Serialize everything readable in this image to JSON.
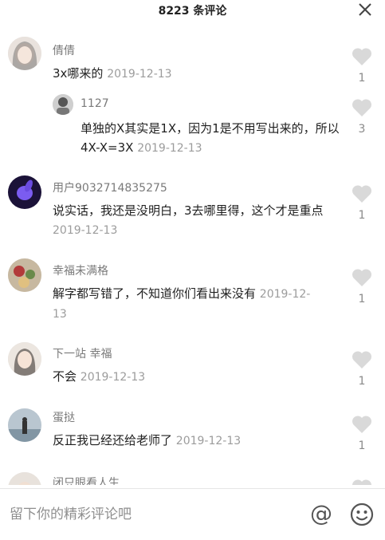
{
  "header": {
    "title": "8223 条评论",
    "close_icon": "close-icon"
  },
  "comments": [
    {
      "username": "倩倩",
      "text": "3x哪来的",
      "date": "2019-12-13",
      "likes": "1",
      "reply": {
        "username": "1127",
        "text": "单独的X其实是1X，因为1是不用写出来的，所以4X-X=3X",
        "date": "2019-12-13",
        "likes": "3"
      }
    },
    {
      "username": "用户9032714835275",
      "text": "说实话，我还是没明白，3去哪里得，这个才是重点",
      "date": "2019-12-13",
      "likes": "1"
    },
    {
      "username": "幸福未满格",
      "text": "解字都写错了，不知道你们看出来没有",
      "date": "2019-12-13",
      "likes": "1"
    },
    {
      "username": "下一站 幸福",
      "text": "不会",
      "date": "2019-12-13",
      "likes": "1"
    },
    {
      "username": "蛋挞",
      "text": "反正我已经还给老师了",
      "date": "2019-12-13",
      "likes": "1"
    },
    {
      "username": "闭只眼看人生"
    }
  ],
  "bottom_bar": {
    "placeholder": "留下你的精彩评论吧",
    "at_symbol": "@",
    "emoji_icon": "smiley-icon"
  },
  "colors": {
    "username": "#7a7a7a",
    "date": "#9c9c9c",
    "like_heart": "#d9d9d9"
  }
}
